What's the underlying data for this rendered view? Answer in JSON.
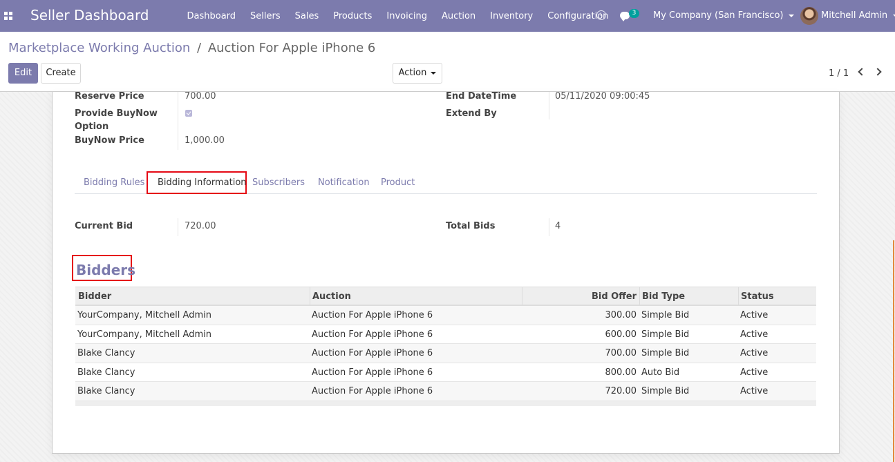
{
  "app": {
    "brand": "Seller Dashboard",
    "menu": [
      "Dashboard",
      "Sellers",
      "Sales",
      "Products",
      "Invoicing",
      "Auction",
      "Inventory",
      "Configuration"
    ],
    "chat_count": "3",
    "company": "My Company (San Francisco)",
    "user": "Mitchell Admin",
    "accent_color": "#7c7bad"
  },
  "breadcrumb": {
    "parent": "Marketplace Working Auction",
    "separator": "/",
    "current": "Auction For Apple iPhone 6"
  },
  "toolbar": {
    "edit_label": "Edit",
    "create_label": "Create",
    "action_label": "Action",
    "pager": "1 / 1"
  },
  "fields": {
    "reserve_price_label": "Reserve Price",
    "reserve_price_value": "700.00",
    "buynow_option_label_1": "Provide BuyNow",
    "buynow_option_label_2": "Option",
    "buynow_option_checked": true,
    "buynow_price_label": "BuyNow Price",
    "buynow_price_value": "1,000.00",
    "end_datetime_label": "End DateTime",
    "end_datetime_value": "05/11/2020 09:00:45",
    "extend_by_label": "Extend By",
    "extend_by_value": ""
  },
  "tabs": {
    "items": [
      "Bidding Rules",
      "Bidding Information",
      "Subscribers",
      "Notification",
      "Product"
    ],
    "active": "Bidding Information"
  },
  "bidding_info": {
    "current_bid_label": "Current Bid",
    "current_bid_value": "720.00",
    "total_bids_label": "Total Bids",
    "total_bids_value": "4"
  },
  "bidders": {
    "title": "Bidders",
    "columns": [
      "Bidder",
      "Auction",
      "Bid Offer",
      "Bid Type",
      "Status"
    ],
    "rows": [
      [
        "YourCompany, Mitchell Admin",
        "Auction For Apple iPhone 6",
        "300.00",
        "Simple Bid",
        "Active"
      ],
      [
        "YourCompany, Mitchell Admin",
        "Auction For Apple iPhone 6",
        "600.00",
        "Simple Bid",
        "Active"
      ],
      [
        "Blake Clancy",
        "Auction For Apple iPhone 6",
        "700.00",
        "Simple Bid",
        "Active"
      ],
      [
        "Blake Clancy",
        "Auction For Apple iPhone 6",
        "800.00",
        "Auto Bid",
        "Active"
      ],
      [
        "Blake Clancy",
        "Auction For Apple iPhone 6",
        "720.00",
        "Simple Bid",
        "Active"
      ]
    ]
  }
}
